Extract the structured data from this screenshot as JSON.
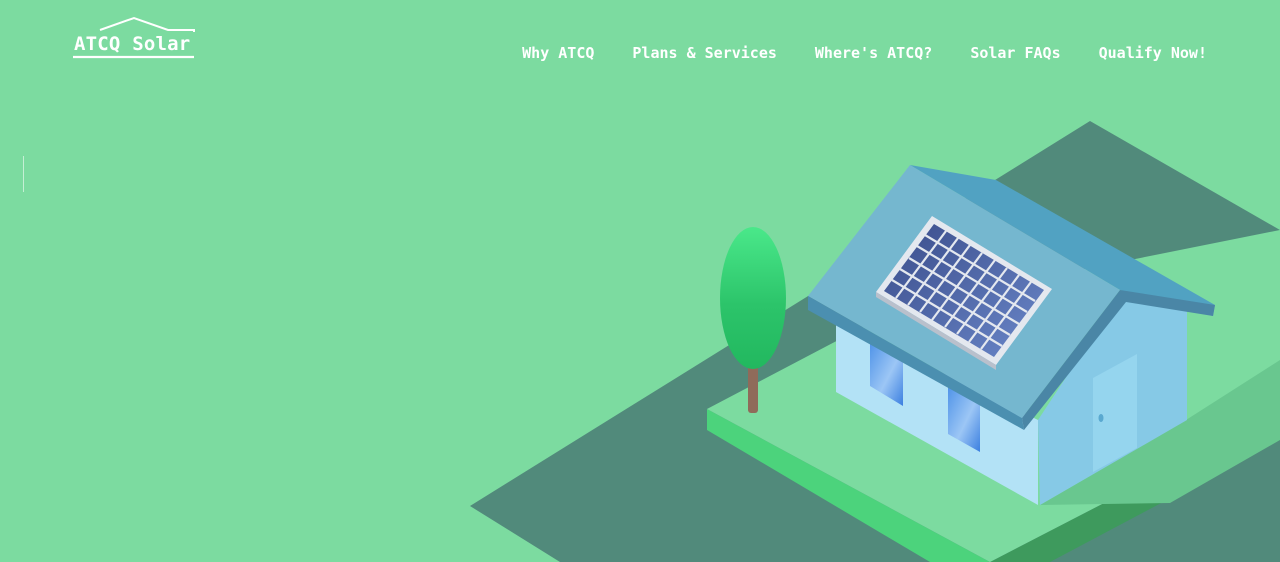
{
  "brand": {
    "name": "ATCQ Solar"
  },
  "nav": {
    "items": [
      {
        "label": "Why ATCQ"
      },
      {
        "label": "Plans & Services"
      },
      {
        "label": "Where's ATCQ?"
      },
      {
        "label": "Solar FAQs"
      },
      {
        "label": "Qualify Now!"
      }
    ]
  },
  "colors": {
    "background": "#7cdba0",
    "ground_shadow": "#518a7b",
    "lawn": "#7cdba0",
    "lawn_edge": "#4cd37c",
    "roof_top": "#75b7cf",
    "roof_side": "#51a2c2",
    "wall_front": "#b3e2f6",
    "wall_side": "#86c9e6",
    "panel": "#3f5590",
    "tree": "#2fc86b",
    "trunk": "#8f6b5a",
    "text": "#ffffff"
  },
  "icons": {
    "logo_roof": "house-roof-outline-icon"
  }
}
